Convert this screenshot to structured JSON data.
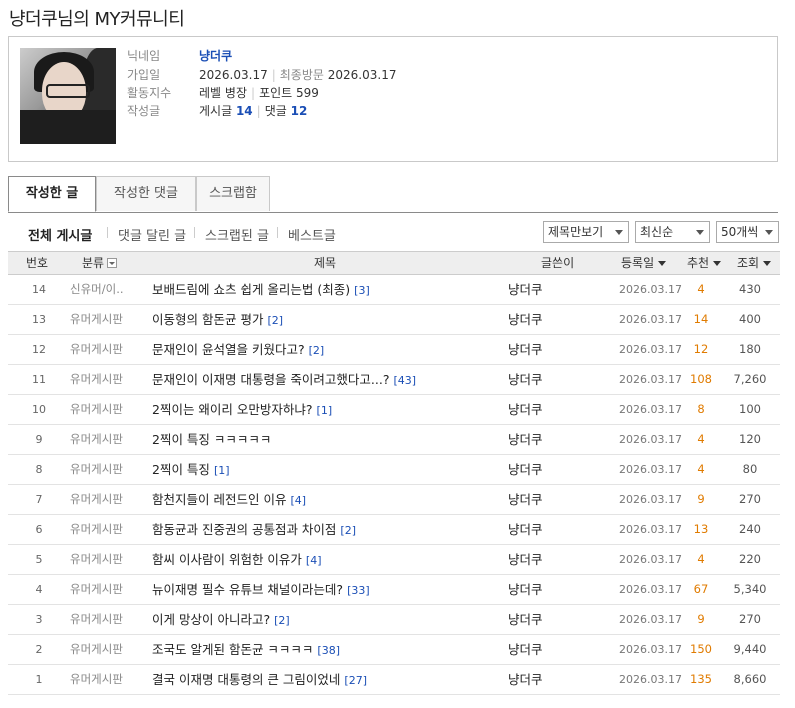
{
  "page": {
    "title": "냥더쿠님의 MY커뮤니티"
  },
  "profile": {
    "nickname_label": "닉네임",
    "nickname": "냥더쿠",
    "joined_label": "가입일",
    "joined": "2026.03.17",
    "last_visit_label": "최종방문",
    "last_visit": "2026.03.17",
    "activity_label": "활동지수",
    "level_label": "레벨",
    "level": "병장",
    "points_label": "포인트",
    "points": "599",
    "posts_label": "작성글",
    "post_count_label": "게시글",
    "post_count": "14",
    "comment_count_label": "댓글",
    "comment_count": "12"
  },
  "tabs": [
    {
      "label": "작성한 글",
      "active": true
    },
    {
      "label": "작성한 댓글",
      "active": false
    },
    {
      "label": "스크랩함",
      "active": false
    }
  ],
  "filters": [
    {
      "label": "전체 게시글",
      "active": true
    },
    {
      "label": "댓글 달린 글",
      "active": false
    },
    {
      "label": "스크랩된 글",
      "active": false
    },
    {
      "label": "베스트글",
      "active": false
    }
  ],
  "selects": {
    "view_mode": "제목만보기",
    "sort": "최신순",
    "per_page": "50개씩"
  },
  "columns": {
    "no": "번호",
    "category": "분류",
    "title": "제목",
    "author": "글쓴이",
    "date": "등록일",
    "recommend": "추천",
    "views": "조회"
  },
  "rows": [
    {
      "no": "14",
      "category": "신유머/이..",
      "title": "보배드림에 쇼츠 쉽게 올리는법 (최종)",
      "comments": "[3]",
      "author": "냥더쿠",
      "date": "2026.03.17",
      "recommend": "4",
      "views": "430"
    },
    {
      "no": "13",
      "category": "유머게시판",
      "title": "이동형의 함돈균 평가",
      "comments": "[2]",
      "author": "냥더쿠",
      "date": "2026.03.17",
      "recommend": "14",
      "views": "400"
    },
    {
      "no": "12",
      "category": "유머게시판",
      "title": "문재인이 윤석열을 키웠다고?",
      "comments": "[2]",
      "author": "냥더쿠",
      "date": "2026.03.17",
      "recommend": "12",
      "views": "180"
    },
    {
      "no": "11",
      "category": "유머게시판",
      "title": "문재인이 이재명 대통령을 죽이려고했다고...?",
      "comments": "[43]",
      "author": "냥더쿠",
      "date": "2026.03.17",
      "recommend": "108",
      "views": "7,260"
    },
    {
      "no": "10",
      "category": "유머게시판",
      "title": "2찍이는 왜이리 오만방자하냐?",
      "comments": "[1]",
      "author": "냥더쿠",
      "date": "2026.03.17",
      "recommend": "8",
      "views": "100"
    },
    {
      "no": "9",
      "category": "유머게시판",
      "title": "2찍이 특징 ㅋㅋㅋㅋㅋ",
      "comments": "",
      "author": "냥더쿠",
      "date": "2026.03.17",
      "recommend": "4",
      "views": "120"
    },
    {
      "no": "8",
      "category": "유머게시판",
      "title": "2찍이 특징",
      "comments": "[1]",
      "author": "냥더쿠",
      "date": "2026.03.17",
      "recommend": "4",
      "views": "80"
    },
    {
      "no": "7",
      "category": "유머게시판",
      "title": "함천지들이 레전드인 이유",
      "comments": "[4]",
      "author": "냥더쿠",
      "date": "2026.03.17",
      "recommend": "9",
      "views": "270"
    },
    {
      "no": "6",
      "category": "유머게시판",
      "title": "함동균과 진중권의 공통점과 차이점",
      "comments": "[2]",
      "author": "냥더쿠",
      "date": "2026.03.17",
      "recommend": "13",
      "views": "240"
    },
    {
      "no": "5",
      "category": "유머게시판",
      "title": "함씨 이사람이 위험한 이유가",
      "comments": "[4]",
      "author": "냥더쿠",
      "date": "2026.03.17",
      "recommend": "4",
      "views": "220"
    },
    {
      "no": "4",
      "category": "유머게시판",
      "title": "뉴이재명 필수 유튜브 채널이라는데?",
      "comments": "[33]",
      "author": "냥더쿠",
      "date": "2026.03.17",
      "recommend": "67",
      "views": "5,340"
    },
    {
      "no": "3",
      "category": "유머게시판",
      "title": "이게 망상이 아니라고?",
      "comments": "[2]",
      "author": "냥더쿠",
      "date": "2026.03.17",
      "recommend": "9",
      "views": "270"
    },
    {
      "no": "2",
      "category": "유머게시판",
      "title": "조국도 알게된 함돈균 ㅋㅋㅋㅋ",
      "comments": "[38]",
      "author": "냥더쿠",
      "date": "2026.03.17",
      "recommend": "150",
      "views": "9,440"
    },
    {
      "no": "1",
      "category": "유머게시판",
      "title": "결국 이재명 대통령의 큰 그림이었네",
      "comments": "[27]",
      "author": "냥더쿠",
      "date": "2026.03.17",
      "recommend": "135",
      "views": "8,660"
    }
  ]
}
